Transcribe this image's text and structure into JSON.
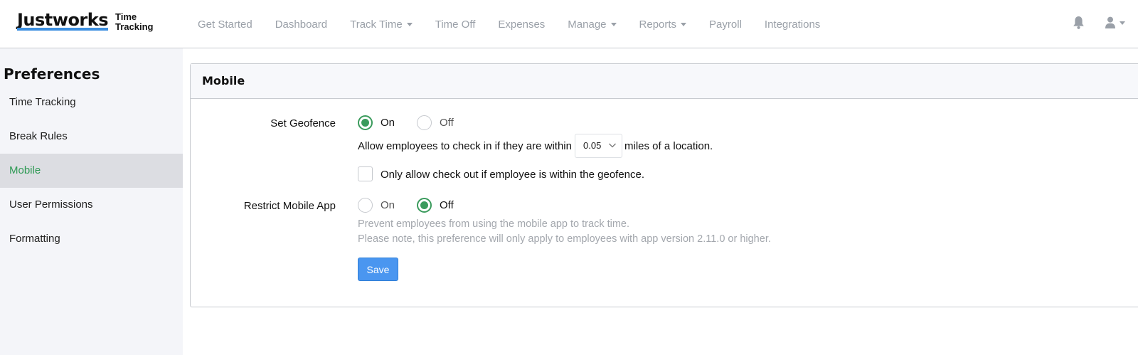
{
  "brand": {
    "name": "Justworks",
    "sub_line1": "Time",
    "sub_line2": "Tracking"
  },
  "nav": {
    "get_started": "Get Started",
    "dashboard": "Dashboard",
    "track_time": "Track Time",
    "time_off": "Time Off",
    "expenses": "Expenses",
    "manage": "Manage",
    "reports": "Reports",
    "payroll": "Payroll",
    "integrations": "Integrations"
  },
  "icons": {
    "notifications": "bell-icon",
    "user": "user-icon"
  },
  "sidebar": {
    "title": "Preferences",
    "items": [
      "Time Tracking",
      "Break Rules",
      "Mobile",
      "User Permissions",
      "Formatting"
    ],
    "active": "Mobile"
  },
  "panel": {
    "title": "Mobile",
    "geofence": {
      "label": "Set Geofence",
      "on": "On",
      "off": "Off",
      "selected": "On",
      "allow_prefix": "Allow employees to check in if they are within",
      "distance": "0.05",
      "allow_suffix": "miles of a location.",
      "checkout_text": "Only allow check out if employee is within the geofence.",
      "checkout_checked": false
    },
    "restrict": {
      "label": "Restrict Mobile App",
      "on": "On",
      "off": "Off",
      "selected": "Off",
      "note1": "Prevent employees from using the mobile app to track time.",
      "note2": "Please note, this preference will only apply to employees with app version 2.11.0 or higher."
    },
    "save_label": "Save"
  },
  "colors": {
    "accent_green": "#3a9b5c",
    "button_blue": "#4a96f0",
    "logo_underline": "#3d8fe0"
  }
}
